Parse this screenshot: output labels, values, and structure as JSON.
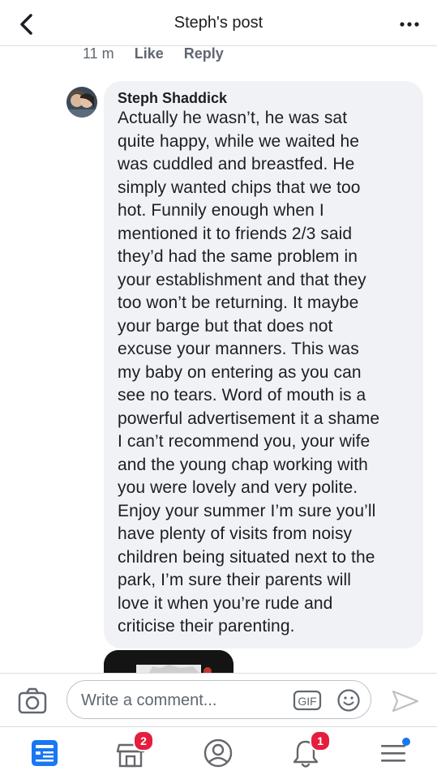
{
  "header": {
    "title": "Steph's post",
    "back_icon": "chevron-left-icon",
    "more_icon": "more-dots-icon"
  },
  "prev_comment_meta": {
    "time": "11 m",
    "like": "Like",
    "reply": "Reply"
  },
  "comment": {
    "author": "Steph Shaddick",
    "text": "Actually he wasn’t, he was sat\nquite happy, while we waited he\nwas cuddled and breastfed. He\nsimply wanted chips that we too\nhot. Funnily enough when I\nmentioned it to friends 2/3 said\nthey’d had the same problem in\nyour establishment and that they\ntoo won’t be returning. It maybe\nyour barge but that does not\nexcuse your manners. This was\nmy baby on entering as you can\nsee no tears. Word of mouth is a\npowerful advertisement it a shame\nI can’t recommend you, your wife\nand the young chap working with\nyou were lovely and very polite.\nEnjoy your summer I’m sure you’ll\nhave plenty of visits from noisy\nchildren being situated next to the\npark, I’m sure their parents will\nlove it when you’re rude and\ncriticise their parenting."
  },
  "composer": {
    "placeholder": "Write a comment...",
    "gif_label": "GIF",
    "camera_icon": "camera-icon",
    "emoji_icon": "emoji-icon",
    "send_icon": "send-icon"
  },
  "tabbar": {
    "items": [
      {
        "icon": "news-feed-icon",
        "badge": ""
      },
      {
        "icon": "marketplace-icon",
        "badge": "2"
      },
      {
        "icon": "profile-icon",
        "badge": ""
      },
      {
        "icon": "notifications-bell-icon",
        "badge": "1"
      },
      {
        "icon": "menu-icon",
        "badge": ""
      }
    ]
  },
  "colors": {
    "accent": "#1877f2",
    "badge": "#e41e3f",
    "bubble": "#f0f2f5"
  }
}
